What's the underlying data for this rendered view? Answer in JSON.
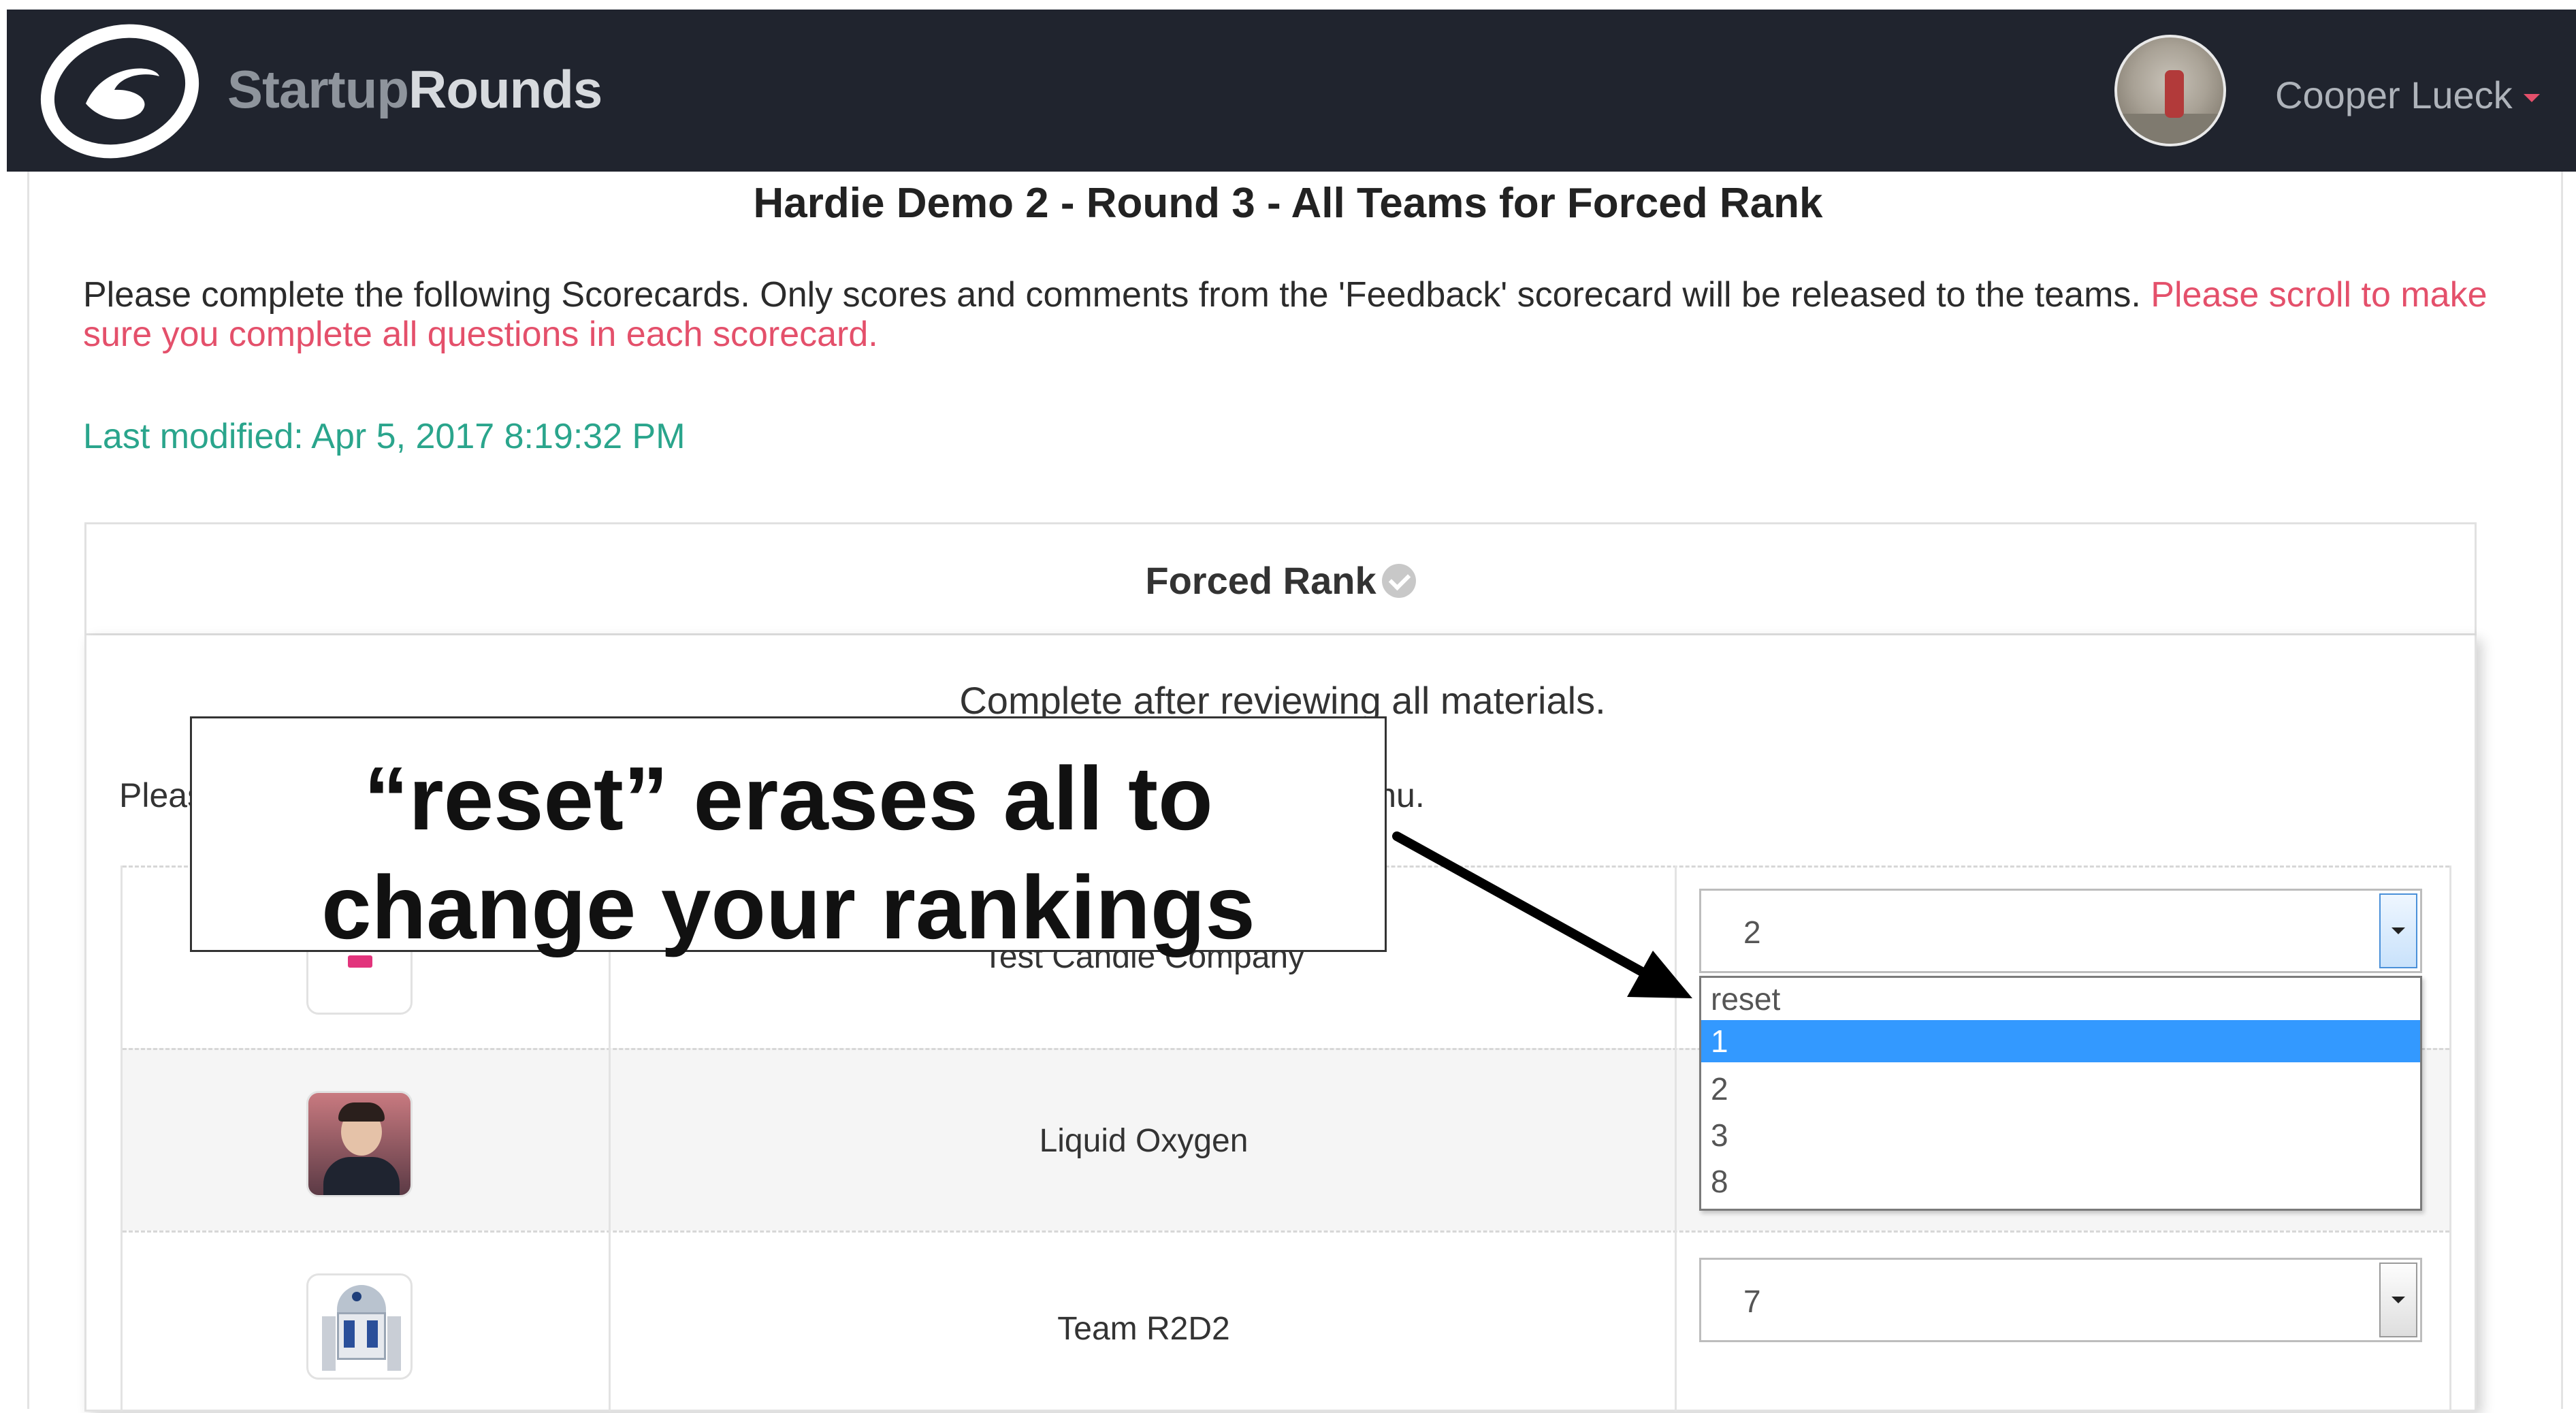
{
  "navbar": {
    "brand_part1": "Startup",
    "brand_part2": "Rounds",
    "user_name": "Cooper Lueck"
  },
  "page": {
    "title": "Hardie Demo 2 - Round 3 - All Teams for Forced Rank",
    "instructions": "Please complete the following Scorecards. Only scores and comments from the 'Feedback' scorecard will be released to the teams.",
    "warning": "Please scroll to make sure you complete all questions in each scorecard.",
    "last_modified": "Last modified: Apr 5, 2017 8:19:32 PM"
  },
  "scorecard": {
    "title": "Forced Rank",
    "description": "Complete after reviewing all materials.",
    "instruction_start": "Pleas",
    "instruction_end": "n menu.",
    "teams": [
      {
        "name": "Test Candle Company",
        "rank": "2",
        "logo": "candle-logo"
      },
      {
        "name": "Liquid Oxygen",
        "rank": "",
        "logo": "person-photo"
      },
      {
        "name": "Team R2D2",
        "rank": "7",
        "logo": "r2d2-robot"
      }
    ],
    "dropdown_options": [
      "reset",
      "1",
      "2",
      "3",
      "8"
    ],
    "dropdown_selected": "1"
  },
  "callout": {
    "line1": "“reset” erases all to",
    "line2": "change your rankings"
  },
  "colors": {
    "navbar_bg": "#20242e",
    "warning": "#e4506b",
    "modified": "#2aa58c",
    "selected_option": "#3399ff"
  }
}
